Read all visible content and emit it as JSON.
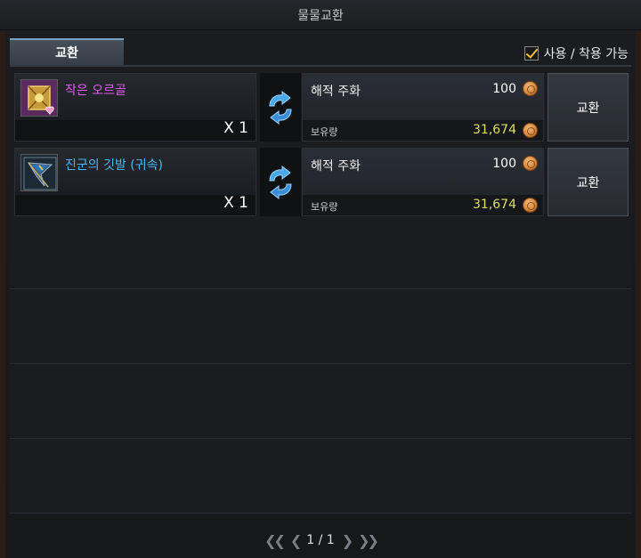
{
  "window": {
    "title": "물물교환"
  },
  "tabs": [
    {
      "label": "교환"
    }
  ],
  "filter": {
    "label": "사용 / 착용 가능",
    "checked": true
  },
  "rows": [
    {
      "item_name": "작은 오르골",
      "item_name_color": "#e05cf0",
      "icon": "music-box-icon",
      "quantity": "X 1",
      "cost_name": "해적 주화",
      "cost_value": "100",
      "held_label": "보유량",
      "held_value": "31,674",
      "button_label": "교환"
    },
    {
      "item_name": "진군의 깃발 (귀속)",
      "item_name_color": "#4ab8f0",
      "icon": "flag-icon",
      "quantity": "X 1",
      "cost_name": "해적 주화",
      "cost_value": "100",
      "held_label": "보유량",
      "held_value": "31,674",
      "button_label": "교환"
    }
  ],
  "pagination": {
    "current": "1 / 1"
  },
  "colors": {
    "accent_tab": "#7aa0c0",
    "held_value": "#d8e060",
    "coin": "#d78a3c"
  }
}
